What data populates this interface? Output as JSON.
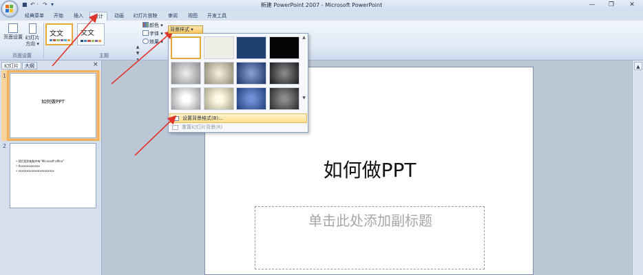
{
  "window": {
    "title": "新建 PowerPoint 2007 - Microsoft PowerPoint",
    "controls": {
      "minimize": "—",
      "restore": "❐",
      "close": "✕"
    }
  },
  "quick_access": {
    "save": "■",
    "undo": "↶ ·",
    "redo": "↷",
    "more": "▾"
  },
  "tabs": [
    "经典菜单",
    "开始",
    "插入",
    "设计",
    "动画",
    "幻灯片放映",
    "审阅",
    "视图",
    "开发工具"
  ],
  "ribbon": {
    "page_setup": {
      "button1": "页面设置",
      "button2": "幻灯片",
      "button2_sub": "方向 ▾",
      "group_label": "页面设置"
    },
    "themes": {
      "thumb1_text": "文文",
      "thumb2_text": "文文",
      "group_label": "主题"
    },
    "commands": {
      "colors": "颜色 ▾",
      "fonts": "字体 ▾",
      "effects": "效果 ▾"
    },
    "background_styles": "背景样式 ▾"
  },
  "dropdown": {
    "items": [
      {
        "label": "设置背景格式(B)...",
        "disabled": false
      },
      {
        "label": "重置幻灯片背景(R)",
        "disabled": true
      }
    ],
    "swatch_colors": [
      "#ffffff",
      "#eeeee6",
      "#1f3f6e",
      "#050505",
      "radial-gradient(circle at 50% 50%, #f0f0f0 0%, #8c8c8c 100%)",
      "radial-gradient(circle at 50% 50%, #f7f3df 0%, #8e8a74 100%)",
      "radial-gradient(circle at 50% 50%, #8ea3d6 0%, #1c3568 100%)",
      "radial-gradient(circle at 50% 50%, #909090 0%, #1a1a1a 100%)",
      "radial-gradient(circle at 50% 50%, #ffffff 20%, #9a9a9a 100%)",
      "radial-gradient(circle at 50% 50%, #fffbe6 20%, #a8a488 100%)",
      "radial-gradient(circle at 50% 50%, #6f8fd8 15%, #20407a 100%)",
      "radial-gradient(circle at 50% 50%, #8a8a8a 15%, #2a2a2a 100%)"
    ]
  },
  "left_pane": {
    "tabs": [
      "幻灯片",
      "大纲"
    ],
    "close": "×",
    "slides": [
      {
        "number": "1",
        "title": "如何做PPT"
      },
      {
        "number": "2",
        "bullets": [
          "• 我们用到电脑中有“Microsoft office”",
          "• Xxxxxxxxxxxxx",
          "• xxxxxxxxxxxxxxxxxxxxxx"
        ]
      }
    ]
  },
  "slide": {
    "title": "如何做PPT",
    "subtitle_placeholder": "单击此处添加副标题"
  },
  "accent": {
    "arrow": "#e0352b",
    "highlight": "#f5c15f"
  }
}
